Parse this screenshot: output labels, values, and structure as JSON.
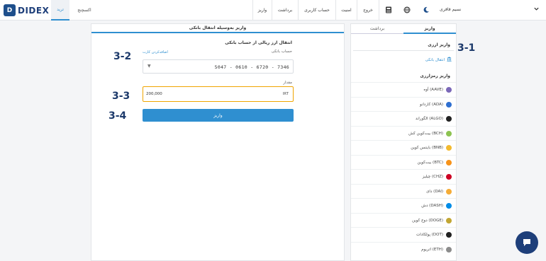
{
  "app": {
    "logo_text": "DIDEX",
    "logo_mark": "D"
  },
  "topbar": {
    "tabs": [
      {
        "label": "ترید",
        "active": true
      },
      {
        "label": "اکسچنج",
        "active": false
      }
    ],
    "nav": [
      "واریز",
      "برداشت",
      "حساب کاربری",
      "امنیت",
      "خروج"
    ],
    "user_name": "نسیم قاقری",
    "icons": [
      "chevron-down-icon",
      "moon-icon",
      "globe-icon",
      "calculator-icon"
    ]
  },
  "left": {
    "header": "واریز به‌وسیله انتقال بانکی",
    "subtitle": "انتقال ارز ریالی از حساب بانکی",
    "bank_account_label": "حساب بانکی",
    "add_card_link": "اضافه‌کردن کارت",
    "card_number": "5047 - 0610 - 6720 - 7346",
    "amount_label": "مقدار",
    "amount_value": "200,000",
    "amount_unit": "IRT",
    "deposit_button": "واریز"
  },
  "annotations": {
    "a1": "3-1",
    "a2": "3-2",
    "a3": "3-3",
    "a4": "3-4"
  },
  "right": {
    "tabs": [
      {
        "label": "واریز",
        "active": true
      },
      {
        "label": "برداشت",
        "active": false
      }
    ],
    "fiat_title": "واریز ارزی",
    "bank_transfer": "انتقال بانکی",
    "crypto_title": "واریز رمزارزی",
    "coins": [
      {
        "name": "آوه (AAVE)",
        "color": "#7b68b8"
      },
      {
        "name": "کاردانو (ADA)",
        "color": "#2f6fd0"
      },
      {
        "name": "الگوراند (ALGO)",
        "color": "#222222"
      },
      {
        "name": "بیت‌کوین کش (BCH)",
        "color": "#8dc351"
      },
      {
        "name": "بایننس کوین (BNB)",
        "color": "#f3ba2f"
      },
      {
        "name": "بیت‌کوین (BTC)",
        "color": "#f7931a"
      },
      {
        "name": "چیلیز (CHZ)",
        "color": "#cd0124"
      },
      {
        "name": "دای (DAI)",
        "color": "#f5ac37"
      },
      {
        "name": "دش (DASH)",
        "color": "#008ce7"
      },
      {
        "name": "دوج کوین (DOGE)",
        "color": "#c2a633"
      },
      {
        "name": "پولکادات (DOT)",
        "color": "#222222"
      },
      {
        "name": "اتریوم (ETH)",
        "color": "#8c8c8c"
      }
    ]
  }
}
